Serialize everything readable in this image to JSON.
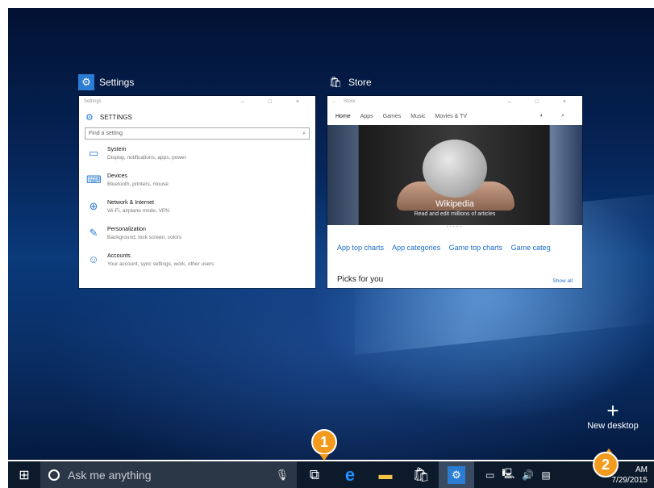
{
  "windows": {
    "settings": {
      "label": "Settings",
      "icon": "gear-icon",
      "titlebar": "Settings",
      "controls": "–  □  ×",
      "heading": "SETTINGS",
      "search_placeholder": "Find a setting",
      "items": [
        {
          "icon": "laptop-icon",
          "title": "System",
          "subtitle": "Display, notifications, apps, power"
        },
        {
          "icon": "devices-icon",
          "title": "Devices",
          "subtitle": "Bluetooth, printers, mouse"
        },
        {
          "icon": "globe-icon",
          "title": "Network & Internet",
          "subtitle": "Wi-Fi, airplane mode, VPN"
        },
        {
          "icon": "brush-icon",
          "title": "Personalization",
          "subtitle": "Background, lock screen, colors"
        },
        {
          "icon": "person-icon",
          "title": "Accounts",
          "subtitle": "Your account, sync settings, work, other users"
        }
      ]
    },
    "store": {
      "label": "Store",
      "icon": "shopping-bag-icon",
      "titlebar": "Store",
      "controls": "–  □  ×",
      "nav": [
        "Home",
        "Apps",
        "Games",
        "Music",
        "Movies & TV"
      ],
      "hero_title": "Wikipedia",
      "hero_subtitle": "Read and edit millions of articles",
      "links": [
        "App top charts",
        "App categories",
        "Game top charts",
        "Game categ"
      ],
      "picks_label": "Picks for you",
      "show_all": "Show all"
    }
  },
  "new_desktop": {
    "label": "New desktop"
  },
  "callouts": {
    "one": "1",
    "two": "2"
  },
  "taskbar": {
    "search_placeholder": "Ask me anything",
    "time": "AM",
    "date": "7/29/2015"
  },
  "colors": {
    "accent": "#2b7cd3",
    "callout": "#f29b1f",
    "taskbar": "#0d1a2c"
  }
}
